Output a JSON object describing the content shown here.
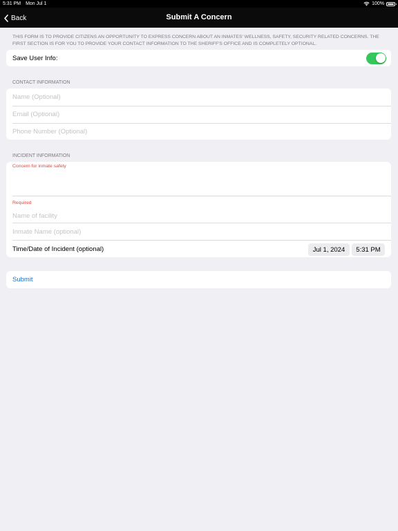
{
  "status_bar": {
    "time": "5:31 PM",
    "date": "Mon Jul 1",
    "battery": "100%",
    "wifi_icon": "wifi-icon",
    "battery_icon": "battery-icon"
  },
  "nav": {
    "back_label": "Back",
    "back_icon": "chevron-left-icon",
    "title": "Submit A Concern"
  },
  "intro_text": "THIS FORM IS TO PROVIDE CITIZENS AN OPPORTUNITY TO EXPRESS CONCERN ABOUT AN INMATES' WELLNESS, SAFETY, SECURITY RELATED CONCERNS.  THE FIRST SECTION IS FOR YOU TO PROVIDE YOUR CONTACT INFORMATION TO THE SHERIFF'S OFFICE AND IS COMPLETELY OPTIONAL.",
  "save_user_info": {
    "label": "Save User Info:",
    "enabled": true,
    "toggle_color": "#34c759"
  },
  "contact": {
    "header": "CONTACT INFORMATION",
    "name_placeholder": "Name (Optional)",
    "email_placeholder": "Email (Optional)",
    "phone_placeholder": "Phone Number (Optional)"
  },
  "incident": {
    "header": "INCIDENT INFORMATION",
    "concern_label": "Concern for inmate safety",
    "concern_value": "",
    "required_label": "Required",
    "facility_placeholder": "Name of facility",
    "inmate_placeholder": "Inmate Name (optional)",
    "datetime_label": "Time/Date of Incident (optional)",
    "date_value": "Jul 1, 2024",
    "time_value": "5:31 PM"
  },
  "submit_label": "Submit",
  "colors": {
    "accent": "#1a73c8",
    "error": "#e0483d",
    "background": "#efeff4"
  }
}
